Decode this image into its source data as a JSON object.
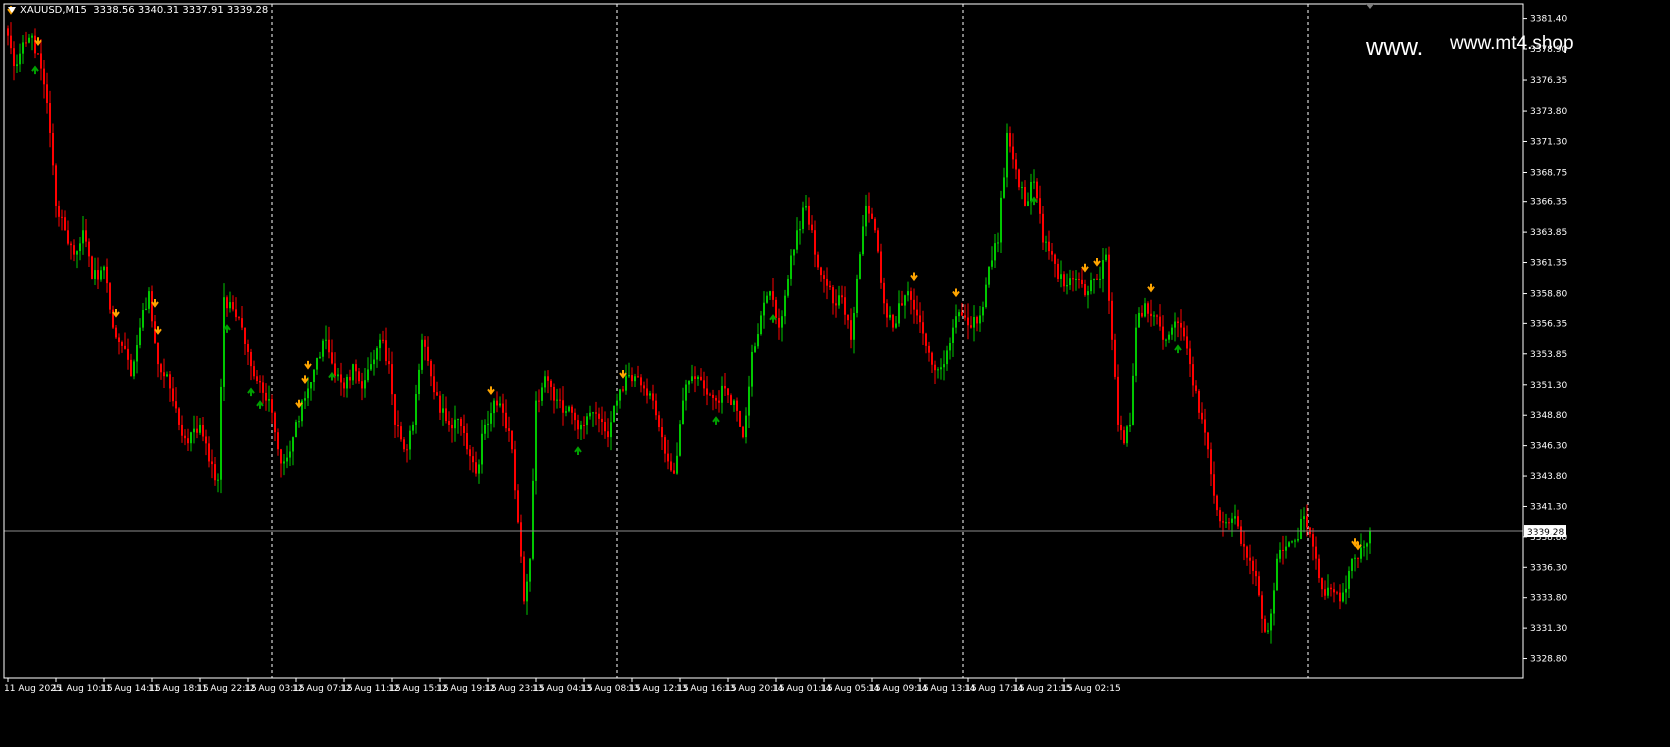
{
  "header": {
    "symbol": "XAUUSD,M15",
    "ohlc": "3338.56 3340.31 3337.91 3339.28"
  },
  "watermark": {
    "left": "www.",
    "right": "www.mt4.shop"
  },
  "colors": {
    "background": "#000000",
    "up_candle": "#00c800",
    "down_candle": "#ff0000",
    "grid": "#ffffff",
    "axis_text": "#ffffff",
    "price_line": "#8c8c8c",
    "sell_arrow": "#ffa500",
    "buy_arrow": "#00a000"
  },
  "chart_data": {
    "type": "candlestick",
    "title": "",
    "xlabel": "",
    "ylabel": "",
    "ylim": [
      3327.2,
      3382.6
    ],
    "y_ticks": [
      "3381.40",
      "3378.90",
      "3376.35",
      "3373.80",
      "3371.30",
      "3368.75",
      "3366.35",
      "3363.85",
      "3361.35",
      "3358.80",
      "3356.35",
      "3353.85",
      "3351.30",
      "3348.80",
      "3346.30",
      "3343.80",
      "3341.30",
      "3338.80",
      "3336.30",
      "3333.80",
      "3331.30",
      "3328.80"
    ],
    "x_labels": [
      "11 Aug 2025",
      "11 Aug 10:15",
      "11 Aug 14:15",
      "11 Aug 18:15",
      "11 Aug 22:15",
      "12 Aug 03:15",
      "12 Aug 07:15",
      "12 Aug 11:15",
      "12 Aug 15:15",
      "12 Aug 19:15",
      "12 Aug 23:15",
      "13 Aug 04:15",
      "13 Aug 08:15",
      "13 Aug 12:15",
      "13 Aug 16:15",
      "13 Aug 20:15",
      "14 Aug 01:15",
      "14 Aug 05:15",
      "14 Aug 09:15",
      "14 Aug 13:15",
      "14 Aug 17:15",
      "14 Aug 21:15",
      "15 Aug 02:15"
    ],
    "day_separators": [
      "11 Aug 2025 23:00",
      "12 Aug 2025 23:00",
      "13 Aug 2025 23:00",
      "14 Aug 2025 23:00"
    ],
    "current_price": "3339.28",
    "bars_per_label": 16,
    "last_index": 454,
    "anchors": [
      [
        0,
        3380
      ],
      [
        2,
        3377.5
      ],
      [
        8,
        3380
      ],
      [
        12,
        3376
      ],
      [
        14,
        3372
      ],
      [
        16,
        3366
      ],
      [
        19,
        3364
      ],
      [
        22,
        3362
      ],
      [
        25,
        3364
      ],
      [
        28,
        3360
      ],
      [
        32,
        3361
      ],
      [
        35,
        3356
      ],
      [
        38,
        3354.5
      ],
      [
        41,
        3352
      ],
      [
        44,
        3356
      ],
      [
        47,
        3359
      ],
      [
        50,
        3353
      ],
      [
        54,
        3351
      ],
      [
        57,
        3348
      ],
      [
        60,
        3346.5
      ],
      [
        64,
        3348
      ],
      [
        67,
        3345
      ],
      [
        70,
        3343.5
      ],
      [
        72,
        3358.5
      ],
      [
        75,
        3357.5
      ],
      [
        78,
        3356
      ],
      [
        80,
        3354
      ],
      [
        82,
        3352
      ],
      [
        84,
        3351.5
      ],
      [
        86,
        3350
      ],
      [
        88,
        3349
      ],
      [
        90,
        3346
      ],
      [
        92,
        3345
      ],
      [
        95,
        3347
      ],
      [
        98,
        3350
      ],
      [
        100,
        3351
      ],
      [
        103,
        3353.5
      ],
      [
        106,
        3355
      ],
      [
        109,
        3352
      ],
      [
        112,
        3351
      ],
      [
        115,
        3353
      ],
      [
        118,
        3351
      ],
      [
        121,
        3353
      ],
      [
        124,
        3355
      ],
      [
        127,
        3353
      ],
      [
        129,
        3348
      ],
      [
        132,
        3346
      ],
      [
        135,
        3348
      ],
      [
        138,
        3355
      ],
      [
        141,
        3352
      ],
      [
        144,
        3349
      ],
      [
        147,
        3348
      ],
      [
        150,
        3348.5
      ],
      [
        153,
        3346
      ],
      [
        156,
        3344
      ],
      [
        159,
        3348
      ],
      [
        162,
        3350
      ],
      [
        165,
        3349
      ],
      [
        168,
        3346
      ],
      [
        170,
        3340
      ],
      [
        172,
        3333.5
      ],
      [
        174,
        3337
      ],
      [
        176,
        3350
      ],
      [
        179,
        3352
      ],
      [
        182,
        3350
      ],
      [
        185,
        3349
      ],
      [
        188,
        3349
      ],
      [
        191,
        3348
      ],
      [
        194,
        3349
      ],
      [
        197,
        3348.5
      ],
      [
        200,
        3347
      ],
      [
        203,
        3350
      ],
      [
        206,
        3352
      ],
      [
        209,
        3352
      ],
      [
        212,
        3351
      ],
      [
        215,
        3350
      ],
      [
        218,
        3347
      ],
      [
        220,
        3345
      ],
      [
        222,
        3344
      ],
      [
        225,
        3350
      ],
      [
        228,
        3352
      ],
      [
        232,
        3351
      ],
      [
        236,
        3350
      ],
      [
        239,
        3351
      ],
      [
        242,
        3350
      ],
      [
        245,
        3347
      ],
      [
        248,
        3354
      ],
      [
        251,
        3357
      ],
      [
        254,
        3359
      ],
      [
        257,
        3356
      ],
      [
        260,
        3360
      ],
      [
        263,
        3364
      ],
      [
        266,
        3366
      ],
      [
        269,
        3362
      ],
      [
        272,
        3360
      ],
      [
        275,
        3358
      ],
      [
        278,
        3358.5
      ],
      [
        281,
        3355
      ],
      [
        283,
        3360
      ],
      [
        286,
        3366
      ],
      [
        289,
        3364
      ],
      [
        292,
        3358
      ],
      [
        295,
        3356
      ],
      [
        297,
        3358
      ],
      [
        300,
        3359
      ],
      [
        303,
        3357
      ],
      [
        306,
        3354.5
      ],
      [
        309,
        3352.5
      ],
      [
        312,
        3353
      ],
      [
        315,
        3356
      ],
      [
        318,
        3357
      ],
      [
        321,
        3356
      ],
      [
        324,
        3357
      ],
      [
        327,
        3361
      ],
      [
        330,
        3363
      ],
      [
        333,
        3372
      ],
      [
        336,
        3369
      ],
      [
        339,
        3366
      ],
      [
        342,
        3368
      ],
      [
        345,
        3363
      ],
      [
        348,
        3362
      ],
      [
        350,
        3360
      ],
      [
        353,
        3359.5
      ],
      [
        356,
        3360
      ],
      [
        360,
        3359
      ],
      [
        363,
        3360
      ],
      [
        366,
        3362
      ],
      [
        368,
        3355
      ],
      [
        370,
        3348
      ],
      [
        372,
        3346.5
      ],
      [
        374,
        3348
      ],
      [
        376,
        3356
      ],
      [
        379,
        3358
      ],
      [
        382,
        3357
      ],
      [
        385,
        3355
      ],
      [
        388,
        3356
      ],
      [
        391,
        3356
      ],
      [
        394,
        3353
      ],
      [
        397,
        3349
      ],
      [
        400,
        3346
      ],
      [
        403,
        3341
      ],
      [
        406,
        3340
      ],
      [
        409,
        3340.5
      ],
      [
        412,
        3338
      ],
      [
        415,
        3336
      ],
      [
        417,
        3334
      ],
      [
        419,
        3331
      ],
      [
        421,
        3332.5
      ],
      [
        423,
        3337
      ],
      [
        426,
        3338
      ],
      [
        429,
        3338.5
      ],
      [
        432,
        3340.5
      ],
      [
        435,
        3338
      ],
      [
        438,
        3334.5
      ],
      [
        441,
        3334.5
      ],
      [
        444,
        3333.5
      ],
      [
        447,
        3336
      ],
      [
        450,
        3337
      ],
      [
        452,
        3338
      ],
      [
        454,
        3339.28
      ]
    ],
    "sell_signals": [
      1,
      10,
      36,
      49,
      50,
      97,
      99,
      100,
      161,
      205,
      302,
      316,
      359,
      363,
      381,
      449,
      450
    ],
    "buy_signals": [
      9,
      73,
      81,
      84,
      108,
      190,
      236,
      255,
      342,
      390
    ]
  }
}
